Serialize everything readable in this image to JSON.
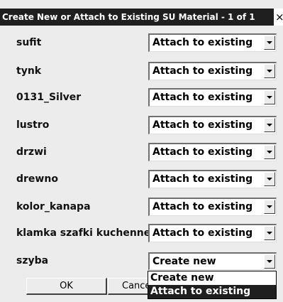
{
  "window": {
    "title": "Create New or Attach to Existing SU Material - 1 of 1",
    "close_label": "×"
  },
  "rows": [
    {
      "label": "sufit",
      "value": "Attach to existing"
    },
    {
      "label": "tynk",
      "value": "Attach to existing"
    },
    {
      "label": "0131_Silver",
      "value": "Attach to existing"
    },
    {
      "label": "lustro",
      "value": "Attach to existing"
    },
    {
      "label": "drzwi",
      "value": "Attach to existing"
    },
    {
      "label": "drewno",
      "value": "Attach to existing"
    },
    {
      "label": "kolor_kanapa",
      "value": "Attach to existing"
    },
    {
      "label": "klamka szafki kuchenne",
      "value": "Attach to existing"
    },
    {
      "label": "szyba",
      "value": "Create new"
    }
  ],
  "dropdown": {
    "options": [
      "Create new",
      "Attach to existing"
    ],
    "highlighted": "Attach to existing"
  },
  "buttons": {
    "ok_label": "OK",
    "cancel_label": "Cance"
  },
  "colors": {
    "titlebar": "#1f1f1f",
    "dialog_bg": "#ececec",
    "highlight": "#1f1f1f"
  }
}
